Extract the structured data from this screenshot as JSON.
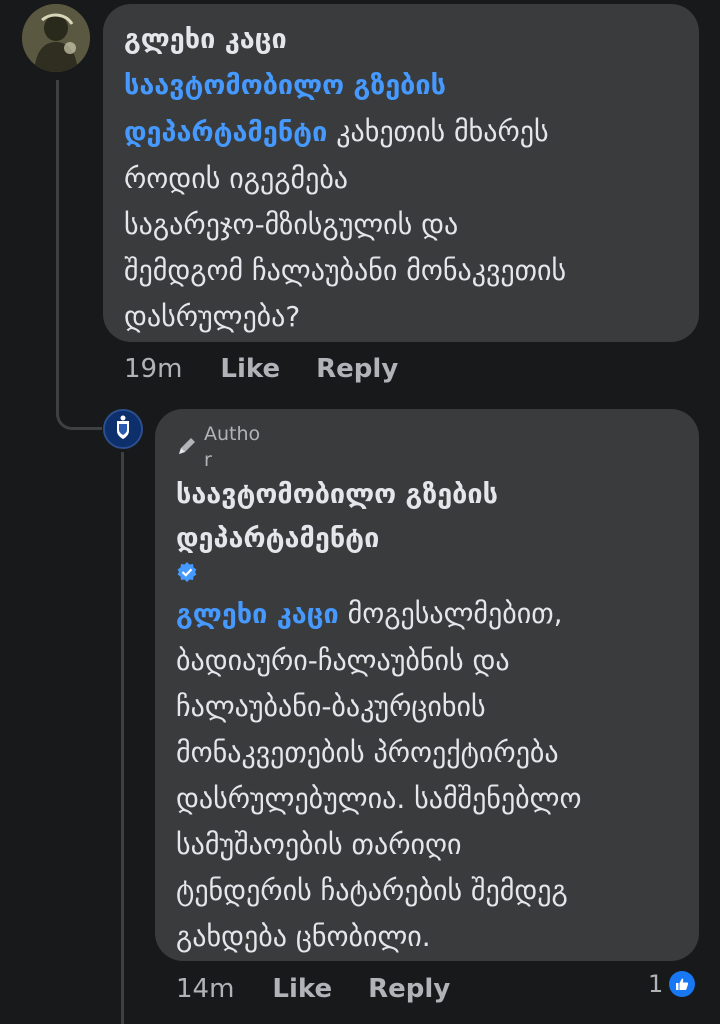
{
  "comment": {
    "author": "გლეხი კაცი",
    "mention_line1": "საავტომობილო გზების",
    "mention_line2": "დეპარტამენტი",
    "text_line1": "კახეთის მხარეს",
    "text_line2": "როდის იგეგმება",
    "text_line3": "საგარეჯო-მზისგულის და",
    "text_line4": "შემდგომ ჩალაუბანი მონაკვეთის",
    "text_line5": "დასრულება?",
    "time": "19m",
    "like_label": "Like",
    "reply_label": "Reply"
  },
  "reply": {
    "badge_label": "Author",
    "author_line1": "საავტომობილო გზების",
    "author_line2": "დეპარტამენტი",
    "mention": "გლეხი კაცი",
    "text_line1": "მოგესალმებით,",
    "text_line2": "ბადიაური-ჩალაუბნის და",
    "text_line3": "ჩალაუბანი-ბაკურციხის",
    "text_line4": "მონაკვეთების პროექტირება",
    "text_line5": "დასრულებულია. სამშენებლო",
    "text_line6": "სამუშაოების თარიღი",
    "text_line7": "ტენდერის ჩატარების შემდეგ",
    "text_line8": "გახდება ცნობილი.",
    "time": "14m",
    "like_label": "Like",
    "reply_label": "Reply",
    "reaction_count": "1"
  },
  "icons": {
    "author_badge": "pen-icon",
    "verified": "verified-badge-icon",
    "reaction": "thumbs-up-icon"
  },
  "colors": {
    "background": "#18191a",
    "bubble": "#3a3b3c",
    "mention": "#4599ff",
    "secondary_text": "#b0b3b8",
    "like_blue": "#1877f2"
  }
}
